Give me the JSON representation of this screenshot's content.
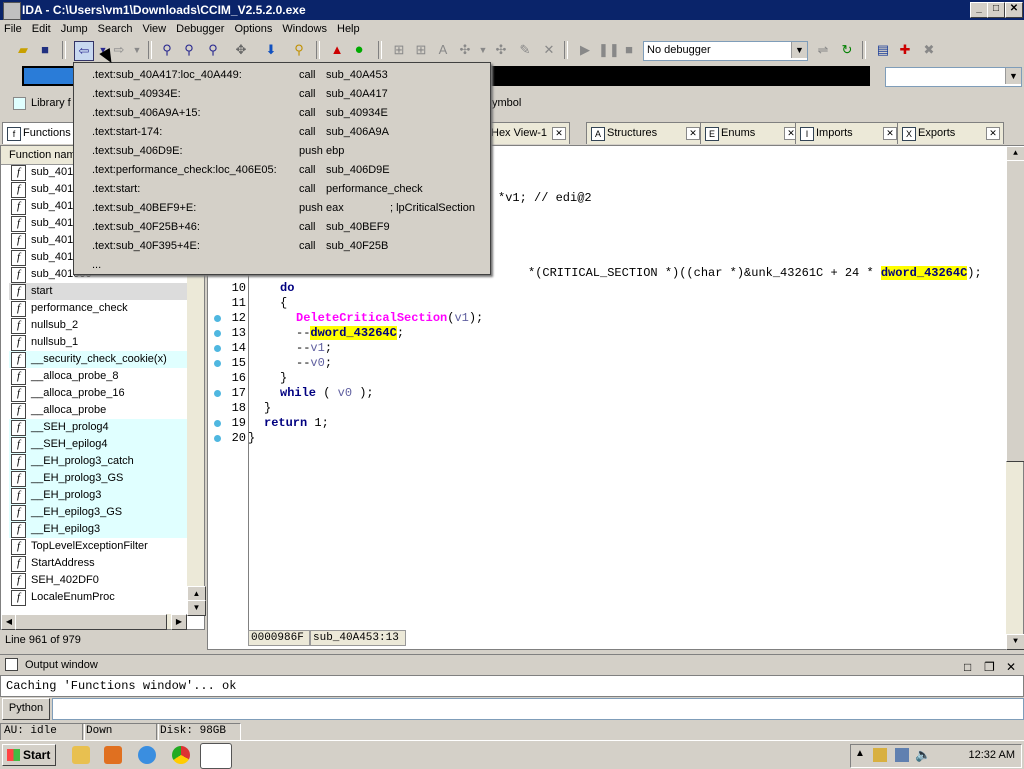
{
  "window": {
    "title": "IDA - C:\\Users\\vm1\\Downloads\\CCIM_V2.5.2.0.exe",
    "min": "_",
    "max": "□",
    "close": "✕"
  },
  "menu": [
    "File",
    "Edit",
    "Jump",
    "Search",
    "View",
    "Debugger",
    "Options",
    "Windows",
    "Help"
  ],
  "toolbar": {
    "debugger_select": "No debugger"
  },
  "legend": {
    "library_label": "Library f",
    "symbol_label": "ymbol"
  },
  "tabs": [
    {
      "label": "Functions",
      "icon": "f"
    },
    {
      "label": "Hex View-1",
      "icon": "H"
    },
    {
      "label": "Structures",
      "icon": "A"
    },
    {
      "label": "Enums",
      "icon": "E"
    },
    {
      "label": "Imports",
      "icon": "I"
    },
    {
      "label": "Exports",
      "icon": "X"
    }
  ],
  "functions": {
    "column_header": "Function nam",
    "items": [
      {
        "name": "sub_401",
        "hl": false
      },
      {
        "name": "sub_401",
        "hl": false
      },
      {
        "name": "sub_401",
        "hl": false
      },
      {
        "name": "sub_401",
        "hl": false
      },
      {
        "name": "sub_401",
        "hl": false
      },
      {
        "name": "sub_401",
        "hl": false
      },
      {
        "name": "sub_401000",
        "hl": false
      },
      {
        "name": "start",
        "hl": false,
        "sel": true
      },
      {
        "name": "performance_check",
        "hl": false
      },
      {
        "name": "nullsub_2",
        "hl": false
      },
      {
        "name": "nullsub_1",
        "hl": false
      },
      {
        "name": "__security_check_cookie(x)",
        "hl": true
      },
      {
        "name": "__alloca_probe_8",
        "hl": false
      },
      {
        "name": "__alloca_probe_16",
        "hl": false
      },
      {
        "name": "__alloca_probe",
        "hl": false
      },
      {
        "name": "__SEH_prolog4",
        "hl": true
      },
      {
        "name": "__SEH_epilog4",
        "hl": true
      },
      {
        "name": "__EH_prolog3_catch",
        "hl": true
      },
      {
        "name": "__EH_prolog3_GS",
        "hl": true
      },
      {
        "name": "__EH_prolog3",
        "hl": true
      },
      {
        "name": "__EH_epilog3_GS",
        "hl": true
      },
      {
        "name": "__EH_epilog3",
        "hl": true
      },
      {
        "name": "TopLevelExceptionFilter",
        "hl": false
      },
      {
        "name": "StartAddress",
        "hl": false
      },
      {
        "name": "SEH_402DF0",
        "hl": false
      },
      {
        "name": "LocaleEnumProc",
        "hl": false
      }
    ],
    "status": "Line 961 of 979"
  },
  "popup": [
    {
      "loc": ".text:sub_40A417:loc_40A449:",
      "op": "call",
      "arg": "sub_40A453",
      "cmt": ""
    },
    {
      "loc": ".text:sub_40934E:",
      "op": "call",
      "arg": "sub_40A417",
      "cmt": ""
    },
    {
      "loc": ".text:sub_406A9A+15:",
      "op": "call",
      "arg": "sub_40934E",
      "cmt": ""
    },
    {
      "loc": ".text:start-174:",
      "op": "call",
      "arg": "sub_406A9A",
      "cmt": ""
    },
    {
      "loc": ".text:sub_406D9E:",
      "op": "push",
      "arg": "ebp",
      "cmt": ""
    },
    {
      "loc": ".text:performance_check:loc_406E05:",
      "op": "call",
      "arg": "sub_406D9E",
      "cmt": ""
    },
    {
      "loc": ".text:start:",
      "op": "call",
      "arg": "performance_check",
      "cmt": ""
    },
    {
      "loc": ".text:sub_40BEF9+E:",
      "op": "push",
      "arg": "eax",
      "cmt": "; lpCriticalSection"
    },
    {
      "loc": ".text:sub_40F25B+46:",
      "op": "call",
      "arg": "sub_40BEF9",
      "cmt": ""
    },
    {
      "loc": ".text:sub_40F395+4E:",
      "op": "call",
      "arg": "sub_40F25B",
      "cmt": ""
    },
    {
      "loc": "...",
      "op": "",
      "arg": "",
      "cmt": ""
    }
  ],
  "code": {
    "partial_top": "*v1; // edi@2",
    "partial_line9": "*(CRITICAL_SECTION *)((char *)&unk_43261C + 24 * ",
    "partial_line9_hl": "dword_43264C",
    "partial_line9_end": ");",
    "line_numbers": [
      "10",
      "11",
      "12",
      "13",
      "14",
      "15",
      "16",
      "17",
      "18",
      "19",
      "20"
    ],
    "l10": "do",
    "l11": "{",
    "l12_fn": "DeleteCriticalSection",
    "l12_open": "(",
    "l12_var": "v1",
    "l12_close": ");",
    "l13_pre": "--",
    "l13_hl": "dword_43264C",
    "l13_end": ";",
    "l14_pre": "--",
    "l14_var": "v1",
    "l14_end": ";",
    "l15_pre": "--",
    "l15_var": "v0",
    "l15_end": ";",
    "l16": "}",
    "l17_kw": "while",
    "l17_open": " ( ",
    "l17_var": "v0",
    "l17_close": " );",
    "l18": "}",
    "l19_kw": "return",
    "l19_end": " 1;",
    "l20": "}",
    "status_addr": "0000986F",
    "status_func": "sub_40A453:13"
  },
  "output": {
    "title": "Output window",
    "text": "Caching 'Functions window'... ok",
    "python_button": "Python"
  },
  "statusbar": {
    "au": "AU:  idle",
    "dir": "Down",
    "disk": "Disk: 98GB"
  },
  "taskbar": {
    "start": "Start",
    "clock": "12:32 AM"
  }
}
